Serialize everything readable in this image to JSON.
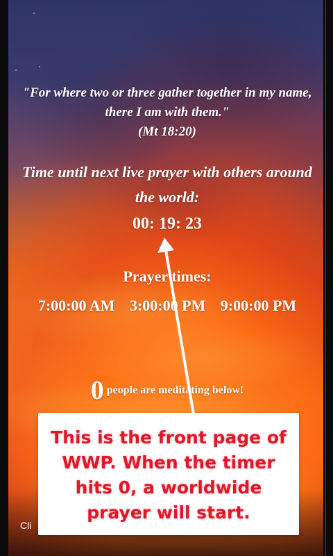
{
  "quote": {
    "text": "\"For where two or three gather together in my name, there I am with them.\"",
    "reference": "(Mt 18:20)"
  },
  "countdown": {
    "title": "Time until next live prayer with others around the world:",
    "timer": "00: 19: 23"
  },
  "prayer_times": {
    "heading": "Prayer times:",
    "times": [
      "7:00:00 AM",
      "3:00:00 PM",
      "9:00:00 PM"
    ]
  },
  "meditating": {
    "count": "0",
    "label": "people are meditating below!"
  },
  "callout": {
    "text": "This is the front page of WWP. When the timer hits 0, a worldwide prayer will start."
  },
  "footer": {
    "click_text": "Cli"
  },
  "colors": {
    "callout_text": "#e01728",
    "text": "#ffffff"
  },
  "icons": {
    "arrow": "up-arrow-icon"
  }
}
